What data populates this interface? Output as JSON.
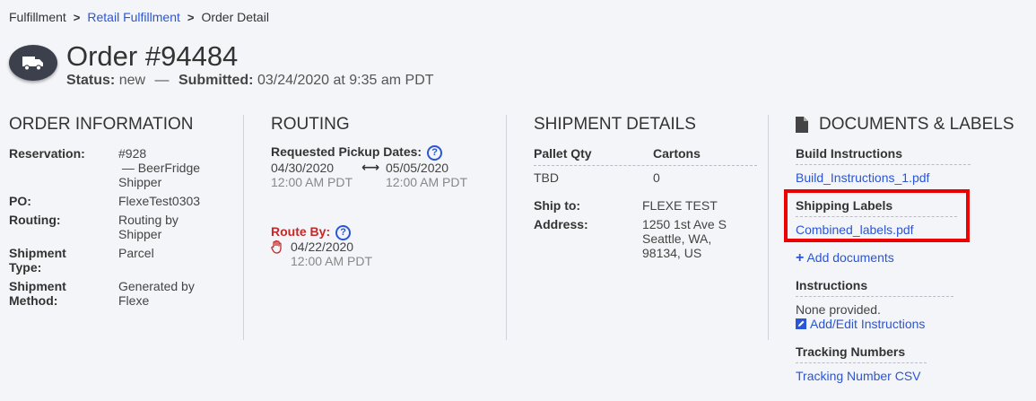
{
  "breadcrumb": {
    "items": [
      "Fulfillment",
      "Retail Fulfillment",
      "Order Detail"
    ],
    "separator": ">"
  },
  "header": {
    "icon": "truck-icon",
    "title": "Order #94484",
    "status_label": "Status:",
    "status_value": "new",
    "dash": "—",
    "submitted_label": "Submitted:",
    "submitted_value": "03/24/2020 at 9:35 am PDT"
  },
  "order_info": {
    "heading": "ORDER INFORMATION",
    "fields": [
      {
        "label": "Reservation:",
        "value": "#928\n — BeerFridge\nShipper"
      },
      {
        "label": "PO:",
        "value": "FlexeTest0303"
      },
      {
        "label": "Routing:",
        "value": "Routing by\nShipper"
      },
      {
        "label": "Shipment\nType:",
        "value": "Parcel"
      },
      {
        "label": "Shipment\nMethod:",
        "value": "Generated by\nFlexe"
      }
    ]
  },
  "routing": {
    "heading": "ROUTING",
    "pickup_label": "Requested Pickup Dates:",
    "pickup_start_date": "04/30/2020",
    "pickup_start_time": "12:00 AM PDT",
    "arrow": "⟷",
    "pickup_end_date": "05/05/2020",
    "pickup_end_time": "12:00 AM PDT",
    "route_by_label": "Route By:",
    "route_by_date": "04/22/2020",
    "route_by_time": "12:00 AM PDT",
    "help": "?"
  },
  "shipment": {
    "heading": "SHIPMENT DETAILS",
    "col1_header": "Pallet Qty",
    "col2_header": "Cartons",
    "pallet_qty": "TBD",
    "cartons": "0",
    "ship_to_label": "Ship to:",
    "ship_to_value": "FLEXE TEST",
    "address_label": "Address:",
    "address_value": "1250 1st Ave S\nSeattle, WA,\n98134, US"
  },
  "documents": {
    "heading": "DOCUMENTS & LABELS",
    "build_heading": "Build Instructions",
    "build_file": "Build_Instructions_1.pdf",
    "shipping_heading": "Shipping Labels",
    "shipping_file": "Combined_labels.pdf",
    "add_documents": "Add documents",
    "instructions_heading": "Instructions",
    "instructions_value": "None provided.",
    "edit_instructions": "Add/Edit Instructions",
    "tracking_heading": "Tracking Numbers",
    "tracking_file": "Tracking Number CSV"
  },
  "colors": {
    "link": "#2a55d6",
    "highlight": "#ee0000",
    "route_by": "#c62828"
  }
}
